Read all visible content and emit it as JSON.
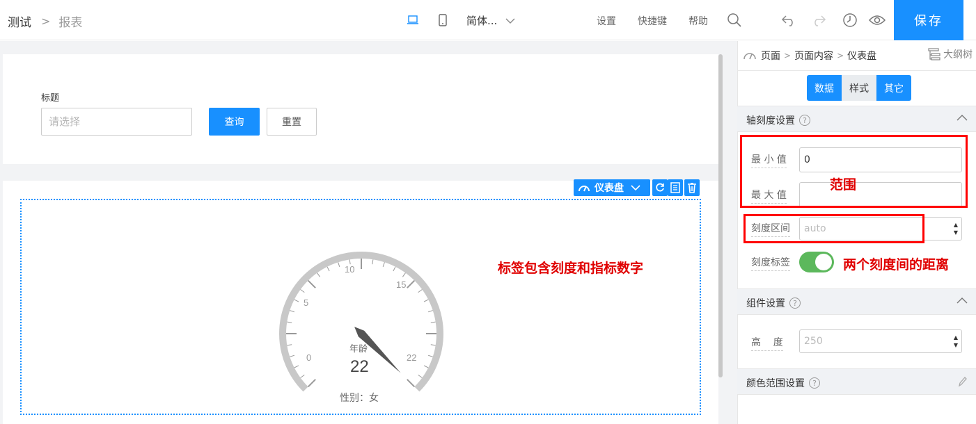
{
  "topbar": {
    "breadcrumb": [
      "测试",
      "报表"
    ],
    "language": "简体...",
    "links": [
      "设置",
      "快捷键",
      "帮助"
    ],
    "save_label": "保存"
  },
  "search": {
    "label": "标题",
    "placeholder": "请选择",
    "query_label": "查询",
    "reset_label": "重置"
  },
  "component": {
    "type_label": "仪表盘"
  },
  "gauge": {
    "ticks": [
      "0",
      "5",
      "10",
      "15",
      "22"
    ],
    "min": 0,
    "max": 22,
    "value": 22,
    "value_text": "22",
    "name": "年龄",
    "subtitle": "性别：女"
  },
  "annotations": {
    "labels_note": "标签包含刻度和指标数字",
    "range_note": "范围",
    "interval_note": "两个刻度间的距离"
  },
  "panel": {
    "breadcrumb": [
      "页面",
      "页面内容",
      "仪表盘"
    ],
    "outline_label": "大纲树",
    "tabs": [
      "数据",
      "样式",
      "其它"
    ],
    "active_tabs": [
      "数据",
      "其它"
    ],
    "axis_section": "轴刻度设置",
    "min_label": "最 小 值",
    "min_value": "0",
    "max_label": "最 大 值",
    "max_value": "",
    "interval_label": "刻度区间",
    "interval_placeholder": "auto",
    "tick_label_label": "刻度标签",
    "tick_label_on": true,
    "component_section": "组件设置",
    "height_label": "高    度",
    "height_placeholder": "250",
    "color_section": "颜色范围设置"
  },
  "colors": {
    "accent": "#1890ff",
    "toggle_on": "#5cb85c",
    "annotation": "#e00000"
  }
}
